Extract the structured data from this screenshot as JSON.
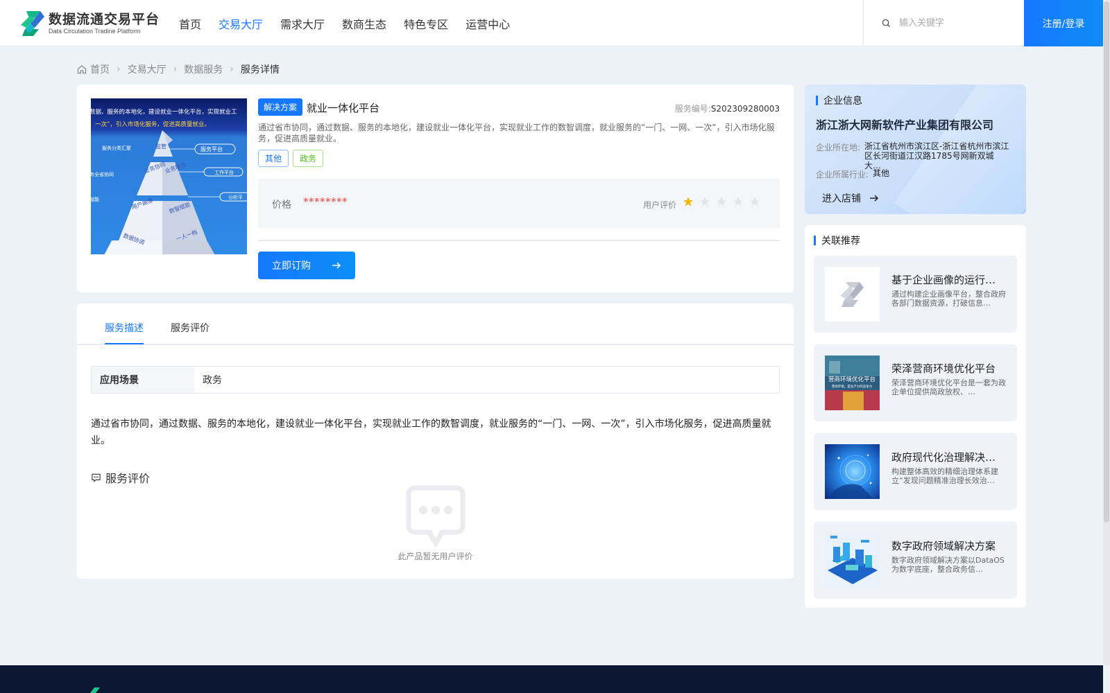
{
  "header": {
    "logo_title": "数据流通交易平台",
    "logo_subtitle": "Data Circulation Tradine Platform",
    "nav": [
      "首页",
      "交易大厅",
      "需求大厅",
      "数商生态",
      "特色专区",
      "运营中心"
    ],
    "active_nav": "交易大厅",
    "search_placeholder": "输入关键字",
    "login_label": "注册/登录"
  },
  "breadcrumb": [
    "首页",
    "交易大厅",
    "数据服务",
    "服务详情"
  ],
  "product": {
    "badge": "解决方案",
    "title": "就业一体化平台",
    "service_no_label": "服务编号:",
    "service_no": "S202309280003",
    "desc": "通过省市协同，通过数据、服务的本地化，建设就业一体化平台，实现就业工作的数智调度，就业服务的“一门、一网、一次”，引入市场化服务，促进高质量就业。",
    "tags": [
      "其他",
      "政务"
    ],
    "price_label": "价格",
    "price_value": "********",
    "rating_label": "用户评价",
    "rating": 1,
    "rating_max": 5,
    "buy_label": "立即订购",
    "image_text": {
      "top_line1": "数据、服务的本地化，建设就业一体化平台，实现就业工",
      "top_line2": "一次”，引入市场化服务，促进高质量就业。",
      "layers": [
        "监管",
        "业务协同",
        "业务联合",
        "用户画像",
        "数智赋能",
        "数据协调",
        "一人一档"
      ],
      "side_labels": [
        "服务分类汇聚",
        "服务平台",
        "工作平台",
        "分析平",
        "务全省协同",
        "赋能"
      ]
    }
  },
  "detail": {
    "tabs": [
      "服务描述",
      "服务评价"
    ],
    "active_tab": "服务描述",
    "scene_label": "应用场景",
    "scene_value": "政务",
    "long_desc": "通过省市协同，通过数据、服务的本地化，建设就业一体化平台，实现就业工作的数智调度，就业服务的“一门、一网、一次”，引入市场化服务，促进高质量就业。",
    "review_title": "服务评价",
    "empty_text": "此产品暂无用户评价"
  },
  "company": {
    "section_title": "企业信息",
    "name": "浙江浙大网新软件产业集团有限公司",
    "location_label": "企业所在地:",
    "location_value": "浙江省杭州市滨江区-浙江省杭州市滨江区长河街道江汉路1785号网新双城大…",
    "industry_label": "企业所属行业:",
    "industry_value": "其他",
    "enter_shop": "进入店铺"
  },
  "related": {
    "section_title": "关联推荐",
    "items": [
      {
        "title": "基于企业画像的运行…",
        "desc": "通过构建企业画像平台，整合政府各部门数据资源，打破信息…"
      },
      {
        "title": "荣泽营商环境优化平台",
        "desc": "荣泽营商环境优化平台是一套为政企单位提供简政放权、…",
        "thumb_text": "营商环境优化平台",
        "thumb_sub": "营商环境，是生产力的竞争力"
      },
      {
        "title": "政府现代化治理解决…",
        "desc": "构建整体高效的精细治理体系建立“发现问题精准治理长效治…"
      },
      {
        "title": "数字政府领域解决方案",
        "desc": "数字政府领域解决方案以DataOS为数字底座，整合政务信…"
      }
    ]
  },
  "colors": {
    "primary": "#1677ff",
    "price": "#f0433b",
    "star_active": "#f7b500",
    "footer": "#0c1833"
  }
}
